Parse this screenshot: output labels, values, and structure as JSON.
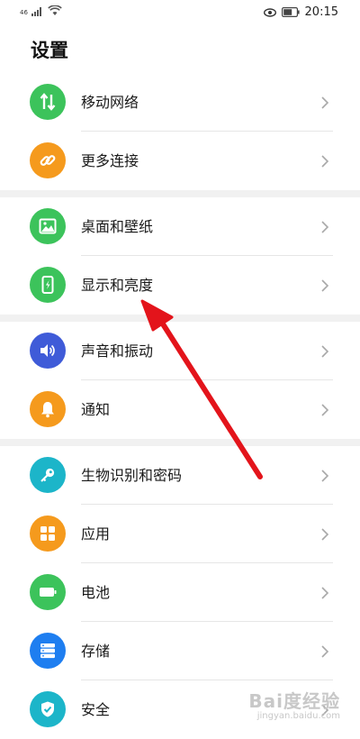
{
  "status_bar": {
    "signal_label": "46",
    "time": "20:15"
  },
  "title": "设置",
  "items": [
    {
      "label": "移动网络",
      "icon": "mobile-data-icon",
      "color": "#3cc35b"
    },
    {
      "label": "更多连接",
      "icon": "link-icon",
      "color": "#f59a1d"
    },
    {
      "label": "桌面和壁纸",
      "icon": "wallpaper-icon",
      "color": "#3cc35b"
    },
    {
      "label": "显示和亮度",
      "icon": "display-brightness-icon",
      "color": "#3cc35b"
    },
    {
      "label": "声音和振动",
      "icon": "speaker-icon",
      "color": "#3f5bd8"
    },
    {
      "label": "通知",
      "icon": "bell-icon",
      "color": "#f59a1d"
    },
    {
      "label": "生物识别和密码",
      "icon": "key-icon",
      "color": "#1cb5c9"
    },
    {
      "label": "应用",
      "icon": "apps-grid-icon",
      "color": "#f59a1d"
    },
    {
      "label": "电池",
      "icon": "battery-icon",
      "color": "#3cc35b"
    },
    {
      "label": "存储",
      "icon": "storage-icon",
      "color": "#1e7ef0"
    },
    {
      "label": "安全",
      "icon": "shield-icon",
      "color": "#1cb5c9"
    }
  ],
  "watermark": {
    "brand": "Bai度经验",
    "url": "jingyan.baidu.com"
  },
  "annotation_color": "#e3141b"
}
